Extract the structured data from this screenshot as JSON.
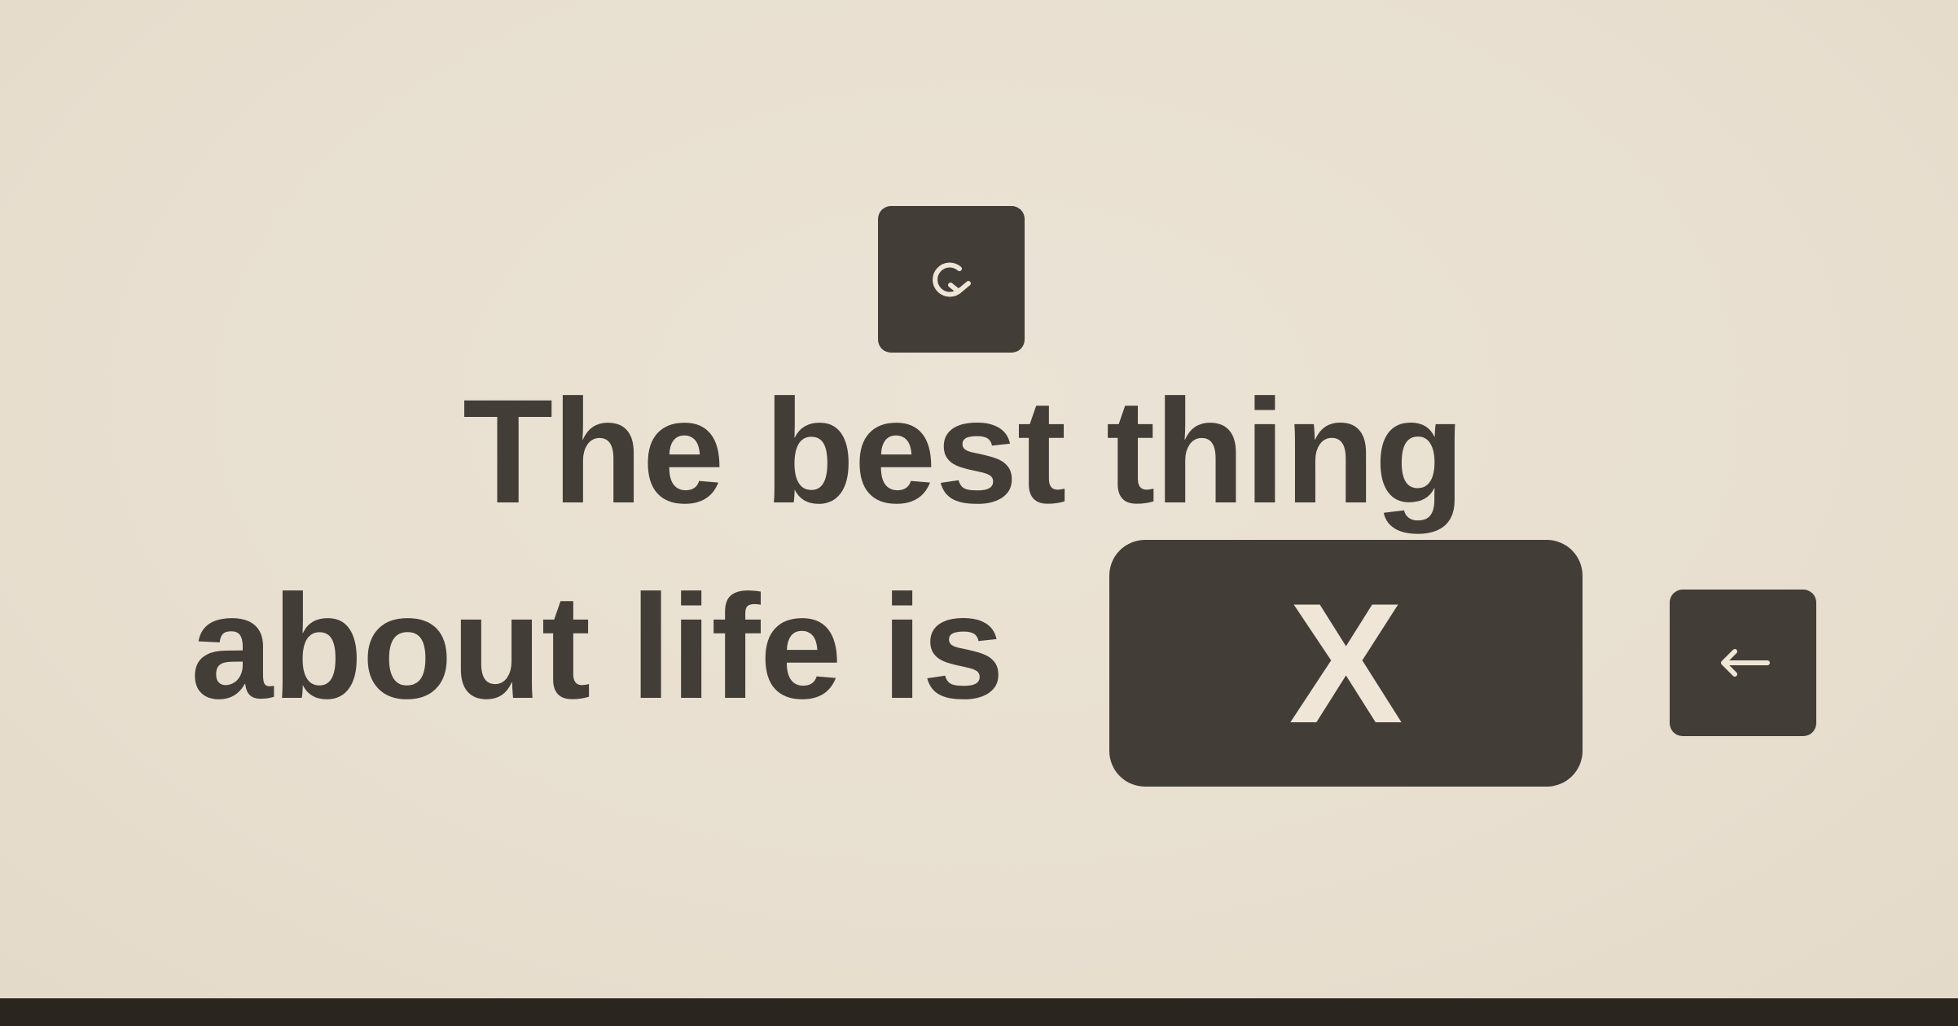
{
  "headline": {
    "line_1": "The best thing",
    "line_2": "about life is"
  },
  "answer": {
    "value": "X"
  },
  "controls": {
    "refresh_icon": "refresh-icon",
    "back_icon": "arrow-left-icon"
  },
  "colors": {
    "background": "#e8dfd0",
    "ink": "#433d37",
    "tile": "#433d37",
    "tile_glyph": "#efe6d8",
    "bottom_bar": "#2b251f"
  }
}
